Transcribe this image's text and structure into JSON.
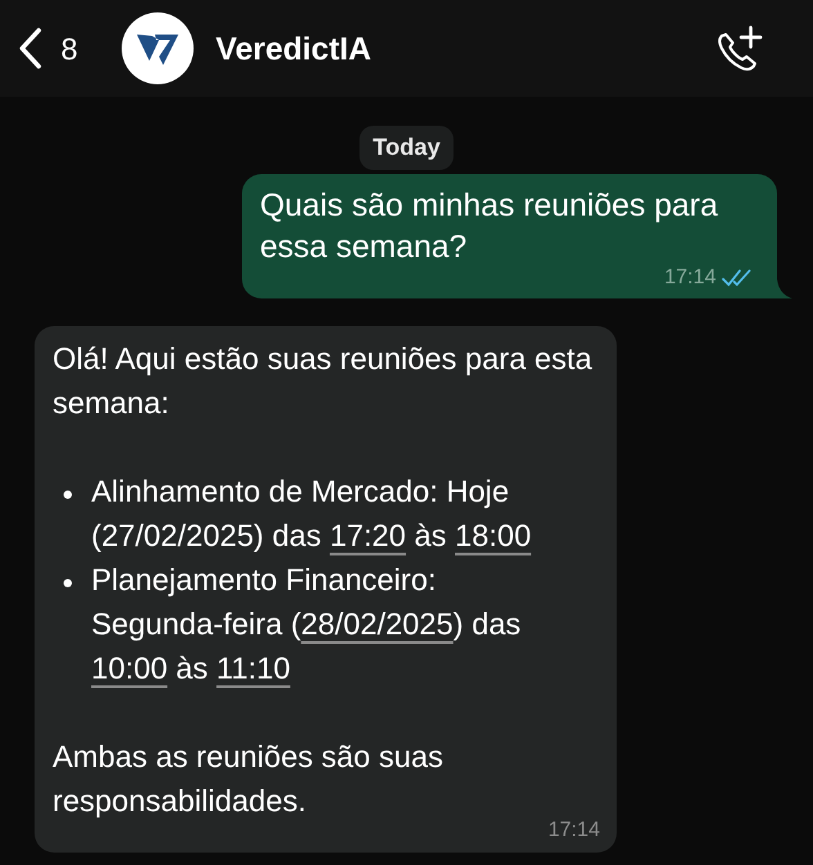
{
  "header": {
    "back_count": "8",
    "title": "VeredictIA"
  },
  "date_label": "Today",
  "messages": [
    {
      "kind": "outgoing",
      "text": "Quais são minhas reuniões para essa semana?",
      "time": "17:14",
      "read": true
    },
    {
      "kind": "incoming",
      "time": "17:14",
      "blocks": [
        {
          "kind": "paragraph",
          "segments": [
            {
              "text": "Olá! Aqui estão suas reuniões para esta semana:",
              "link": false
            }
          ]
        },
        {
          "kind": "bullet",
          "segments": [
            {
              "text": "Alinhamento de Mercado: Hoje (27/02/2025) das ",
              "link": false
            },
            {
              "text": "17:20",
              "link": true
            },
            {
              "text": " às ",
              "link": false
            },
            {
              "text": "18:00",
              "link": true
            }
          ]
        },
        {
          "kind": "bullet",
          "segments": [
            {
              "text": "Planejamento Financeiro: Segunda-feira (",
              "link": false
            },
            {
              "text": "28/02/2025",
              "link": true
            },
            {
              "text": ") das ",
              "link": false
            },
            {
              "text": "10:00",
              "link": true
            },
            {
              "text": " às ",
              "link": false
            },
            {
              "text": "11:10",
              "link": true
            }
          ]
        },
        {
          "kind": "paragraph",
          "segments": [
            {
              "text": "Ambas as reuniões são suas responsabilidades.",
              "link": false
            }
          ]
        }
      ]
    }
  ]
}
